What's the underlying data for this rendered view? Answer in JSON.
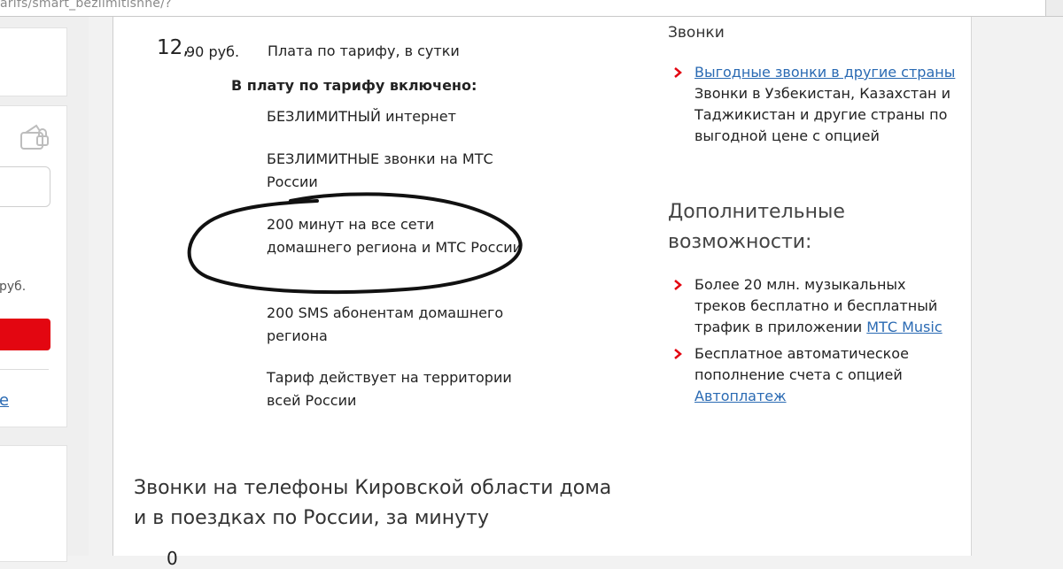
{
  "browser": {
    "url_fragment": "arifs/smart_bezlimitishhe/?"
  },
  "left_panel": {
    "price_fragment": "руб.",
    "link_fragment": "e"
  },
  "main": {
    "price_integer": "12,",
    "price_fraction": "90 руб.",
    "price_description": "Плата по тарифу, в сутки",
    "included_heading": "В плату по тарифу включено:",
    "features": [
      "БЕЗЛИМИТНЫЙ интернет",
      "БЕЗЛИМИТНЫЕ звонки на МТС России",
      "200 минут на все сети домашнего региона и МТС России",
      "200 SMS абонентам домашнего региона",
      "Тариф действует на территории всей России"
    ],
    "section_heading": "Звонки на телефоны Кировской области дома и в поездках по России, за минуту",
    "cut_digit": "0"
  },
  "sidebar": {
    "calls_heading": "Звонки",
    "calls_items": [
      {
        "link": "Выгодные звонки в другие страны",
        "text": "Звонки в Узбекистан, Казахстан и Таджикистан и другие страны по выгодной цене с опцией"
      }
    ],
    "extra_heading": "Дополнительные возможности:",
    "extra_items": [
      {
        "text_before": "Более 20 млн. музыкальных треков бесплатно и бесплатный трафик в приложении ",
        "link": "МТС Music"
      },
      {
        "text_before": "Бесплатное автоматическое пополнение счета с опцией ",
        "link": "Автоплатеж"
      }
    ]
  },
  "colors": {
    "accent_red": "#e30611",
    "link_blue": "#2a6ab3",
    "marker_black": "#111111"
  }
}
